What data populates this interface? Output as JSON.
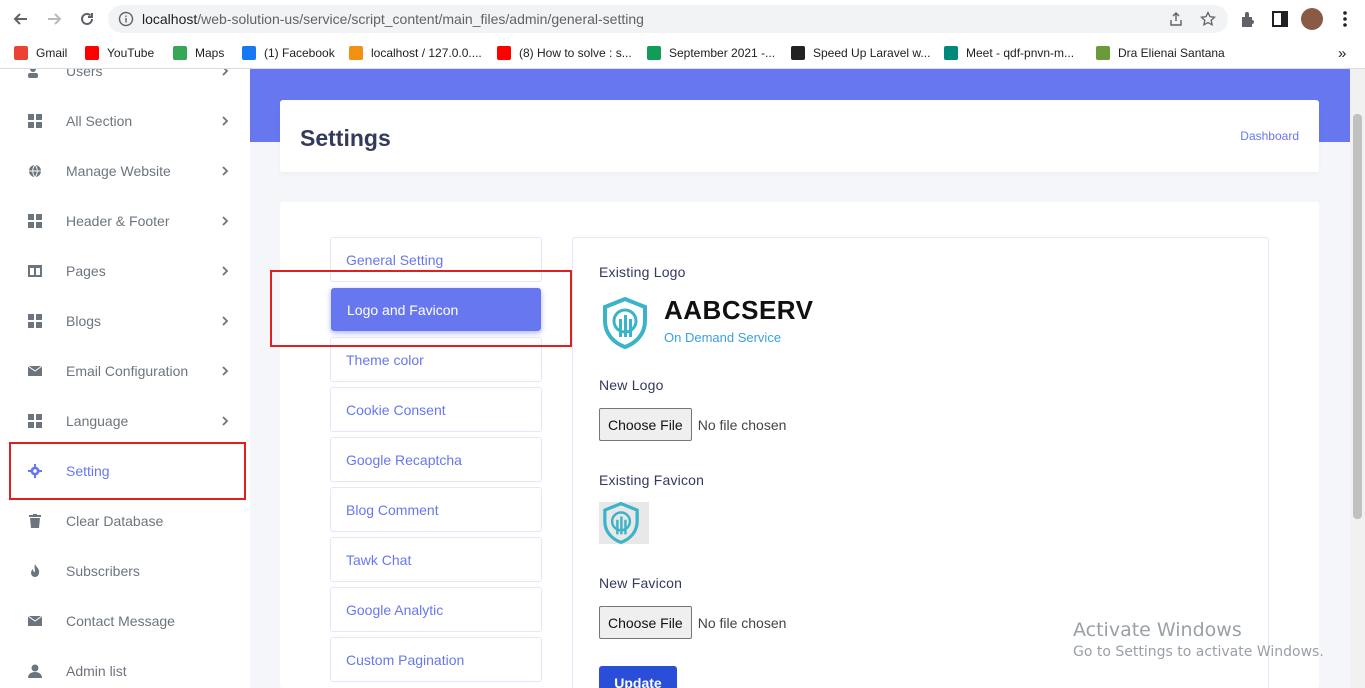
{
  "browser": {
    "url_host": "localhost",
    "url_path": "/web-solution-us/service/script_content/main_files/admin/general-setting",
    "bookmarks": [
      {
        "label": "Gmail",
        "color": "#ea4335"
      },
      {
        "label": "YouTube",
        "color": "#ff0000"
      },
      {
        "label": "Maps",
        "color": "#34a853"
      },
      {
        "label": "(1) Facebook",
        "color": "#1877f2"
      },
      {
        "label": "localhost / 127.0.0....",
        "color": "#f29111"
      },
      {
        "label": "(8) How to solve : s...",
        "color": "#ff0000"
      },
      {
        "label": "September 2021 -...",
        "color": "#0f9d58"
      },
      {
        "label": "Speed Up Laravel w...",
        "color": "#222222"
      },
      {
        "label": "Meet - qdf-pnvn-m...",
        "color": "#00897b"
      },
      {
        "label": "Dra Elienai Santana",
        "color": "#6a9a3a"
      }
    ],
    "more_bookmarks": "»"
  },
  "sidebar": {
    "items": [
      {
        "label": "Users",
        "icon": "users-icon",
        "arrow": true
      },
      {
        "label": "All Section",
        "icon": "grid-icon",
        "arrow": true
      },
      {
        "label": "Manage Website",
        "icon": "globe-icon",
        "arrow": true
      },
      {
        "label": "Header & Footer",
        "icon": "grid-icon",
        "arrow": true
      },
      {
        "label": "Pages",
        "icon": "columns-icon",
        "arrow": true
      },
      {
        "label": "Blogs",
        "icon": "grid-icon",
        "arrow": true
      },
      {
        "label": "Email Configuration",
        "icon": "envelope-icon",
        "arrow": true
      },
      {
        "label": "Language",
        "icon": "grid-icon",
        "arrow": true
      },
      {
        "label": "Setting",
        "icon": "gear-icon",
        "arrow": false
      },
      {
        "label": "Clear Database",
        "icon": "trash-icon",
        "arrow": false
      },
      {
        "label": "Subscribers",
        "icon": "fire-icon",
        "arrow": false
      },
      {
        "label": "Contact Message",
        "icon": "envelope-icon",
        "arrow": false
      },
      {
        "label": "Admin list",
        "icon": "user-icon",
        "arrow": false
      }
    ]
  },
  "header": {
    "title": "Settings",
    "breadcrumb": "Dashboard"
  },
  "tabs": [
    "General Setting",
    "Logo and Favicon",
    "Theme color",
    "Cookie Consent",
    "Google Recaptcha",
    "Blog Comment",
    "Tawk Chat",
    "Google Analytic",
    "Custom Pagination"
  ],
  "active_tab": "Logo and Favicon",
  "form": {
    "existing_logo_label": "Existing Logo",
    "logo_name": "AABCSERV",
    "logo_tagline": "On Demand Service",
    "new_logo_label": "New Logo",
    "choose_file": "Choose File",
    "no_file": "No file chosen",
    "existing_favicon_label": "Existing Favicon",
    "new_favicon_label": "New Favicon",
    "update_button": "Update"
  },
  "watermark": {
    "title": "Activate Windows",
    "subtitle": "Go to Settings to activate Windows."
  },
  "colors": {
    "primary": "#6777ef",
    "highlight": "#e02020",
    "update_button": "#2a4ed8"
  }
}
